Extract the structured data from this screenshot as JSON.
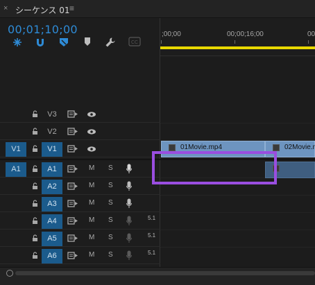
{
  "tab": {
    "close": "×",
    "title": "シーケンス 01",
    "menu": "≡"
  },
  "header": {
    "timecode": "00;01;10;00",
    "tools": [
      "snap-icon",
      "magnet-icon",
      "marker-icon",
      "bookmark-icon",
      "wrench-icon",
      "captions-icon"
    ],
    "captions_label": "CC"
  },
  "ruler": {
    "ticks": [
      ";00;00",
      "00;00;16;00",
      "00;"
    ]
  },
  "tracks": {
    "video": [
      {
        "source": "",
        "name": "V3",
        "enabled": false
      },
      {
        "source": "",
        "name": "V2",
        "enabled": false
      },
      {
        "source": "V1",
        "name": "V1",
        "enabled": true
      }
    ],
    "audio": [
      {
        "source": "A1",
        "name": "A1",
        "enabled": true,
        "mute": "M",
        "solo": "S",
        "channel": ""
      },
      {
        "source": "",
        "name": "A2",
        "enabled": true,
        "mute": "M",
        "solo": "S",
        "channel": ""
      },
      {
        "source": "",
        "name": "A3",
        "enabled": true,
        "mute": "M",
        "solo": "S",
        "channel": ""
      },
      {
        "source": "",
        "name": "A4",
        "enabled": true,
        "mute": "M",
        "solo": "S",
        "channel": "5.1"
      },
      {
        "source": "",
        "name": "A5",
        "enabled": true,
        "mute": "M",
        "solo": "S",
        "channel": "5.1"
      },
      {
        "source": "",
        "name": "A6",
        "enabled": true,
        "mute": "M",
        "solo": "S",
        "channel": "5.1"
      }
    ]
  },
  "clips": {
    "v1": [
      {
        "label": "01Movie.mp4"
      },
      {
        "label": "02Movie.m"
      }
    ]
  },
  "colors": {
    "accent": "#2e8bd6",
    "track_enabled": "#1b5b8c",
    "video_clip": "#6d94c0",
    "audio_clip": "#3f5e80",
    "work_area": "#e8d800",
    "highlight": "#9a4ee0"
  }
}
